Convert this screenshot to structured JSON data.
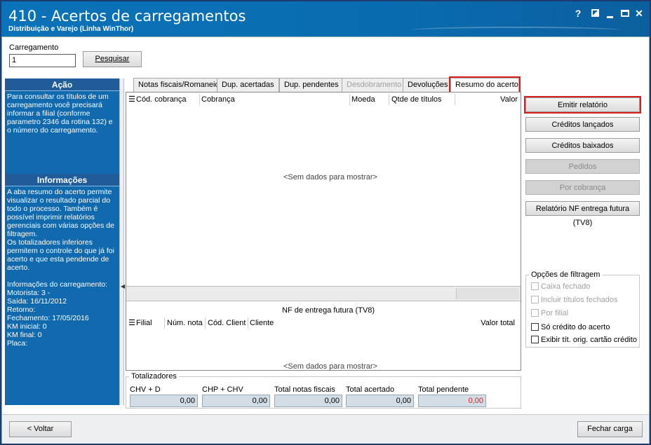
{
  "window": {
    "title": "410 - Acertos de carregamentos",
    "subtitle": "Distribuição e Varejo (Linha WinThor)",
    "controls": {
      "help": "?",
      "close": "✕"
    }
  },
  "search": {
    "label": "Carregamento",
    "value": "1",
    "button": "Pesquisar"
  },
  "sidebar": {
    "action_title": "Ação",
    "action_text": "Para consultar os títulos de um carregamento você precisará informar a filial (conforme parametro 2346 da rotina 132) e o número do carregamento.",
    "info_title": "Informações",
    "info_text": "A aba resumo do acerto permite visualizar o resultado parcial do todo o processo. Também é possível imprimir relatórios gerenciais com várias opções de filtragem.\nOs totalizadores inferiores permitem o controle do que já foi acerto e que esta pendende de acerto.\n\nInformações do carregamento:\nMotorista: 3 -\nSaída: 16/11/2012\nRetorno:\nFechamento: 17/05/2016\nKM inicial: 0\nKM final: 0\nPlaca:"
  },
  "tabs": [
    {
      "label": "Notas fiscais/Romaneio",
      "state": "normal"
    },
    {
      "label": "Dup. acertadas",
      "state": "normal"
    },
    {
      "label": "Dup. pendentes",
      "state": "normal"
    },
    {
      "label": "Desdobramento",
      "state": "disabled"
    },
    {
      "label": "Devoluções",
      "state": "normal"
    },
    {
      "label": "Resumo do acerto",
      "state": "active"
    }
  ],
  "grid1": {
    "columns": [
      "Cód. cobrança",
      "Cobrança",
      "Moeda",
      "Qtde de títulos",
      "Valor"
    ],
    "empty": "<Sem dados para mostrar>"
  },
  "grid2": {
    "title": "NF de entrega futura (TV8)",
    "columns": [
      "Filial",
      "Núm. nota",
      "Cód. Client",
      "Cliente",
      "Valor total"
    ],
    "empty": "<Sem dados para mostrar>"
  },
  "actions": {
    "emitir": "Emitir relatório",
    "creditos_lancados": "Créditos lançados",
    "creditos_baixados": "Créditos baixados",
    "pedidos": "Pedidos",
    "por_cobranca": "Por cobrança",
    "relatorio_nf": "Relatório NF entrega futura (TV8)"
  },
  "filters": {
    "legend": "Opções de filtragem",
    "items": [
      {
        "label": "Caixa fechado",
        "enabled": false
      },
      {
        "label": "Incluir títulos fechados",
        "enabled": false
      },
      {
        "label": "Por filial",
        "enabled": false
      },
      {
        "label": "Só crédito do acerto",
        "enabled": true
      },
      {
        "label": "Exibir tít. orig. cartão crédito",
        "enabled": true
      }
    ]
  },
  "totalizadores": {
    "legend": "Totalizadores",
    "fields": [
      {
        "label": "CHV + D",
        "value": "0,00"
      },
      {
        "label": "CHP + CHV",
        "value": "0,00"
      },
      {
        "label": "Total notas fiscais",
        "value": "0,00"
      },
      {
        "label": "Total acertado",
        "value": "0,00"
      },
      {
        "label": "Total pendente",
        "value": "0,00"
      }
    ],
    "pending_color": "#d62020"
  },
  "footer": {
    "back": "< Voltar",
    "close_load": "Fechar carga"
  }
}
